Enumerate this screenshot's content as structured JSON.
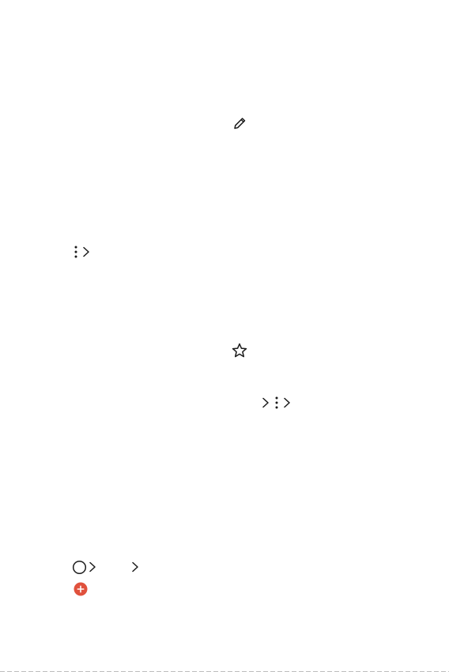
{
  "icons": {
    "edit": "pencil-icon",
    "more_step": [
      "more-vertical-icon",
      "chevron-right-icon"
    ],
    "favorite": "star-outline-icon",
    "nav_step": [
      "chevron-right-icon",
      "more-vertical-icon",
      "chevron-right-icon"
    ],
    "home_step": [
      "home-circle-icon",
      "chevron-right-icon",
      "chevron-right-icon"
    ],
    "add": "add-circle-icon"
  },
  "colors": {
    "text": "#1a1a1a",
    "add_button": "#e0513d",
    "add_symbol": "#ffffff",
    "rule": "#bdbdbd"
  }
}
